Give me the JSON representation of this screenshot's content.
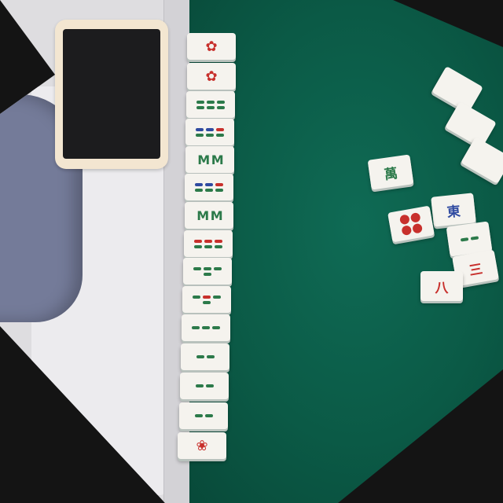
{
  "scene": {
    "objects": [
      "smartphone",
      "sleeve",
      "mahjong-tile-row",
      "loose-mahjong-tiles",
      "green-felt-table"
    ],
    "colors": {
      "felt": "#0b5a46",
      "tile": "#f5f3ee",
      "red": "#c8302c",
      "green": "#2c7a4a",
      "blue": "#2f4aa0"
    }
  },
  "tiles": {
    "east_char": "東",
    "eight_char": "八",
    "three_char": "三",
    "suit_char": "萬"
  }
}
